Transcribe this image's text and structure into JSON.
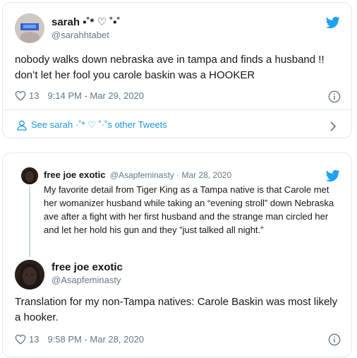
{
  "tweet1": {
    "display_name": "sarah ▪︎˚* ♡ ˚▪︎˚",
    "handle": "@sarahhtabet",
    "text": "nobody walks down nebraska ave in tampa and finds a husband !! don’t let her fool you carole baskin was a HOOKER",
    "likes": "13",
    "timestamp": "9:14 PM - Mar 29, 2020",
    "see_more": "See sarah ·˚* ♡ ˚·˚s other Tweets"
  },
  "tweet2": {
    "quoted": {
      "display_name": "free joe exotic",
      "handle_date": "@Asapfeminasty · Mar 28, 2020",
      "text": "My favorite detail from Tiger King as a Tampa native is that Carole met her womanizer husband while taking an “evening stroll” down Nebraska ave after a fight with her first husband and the strange man circled her and let her hold his gun and they ”just talked all night.”"
    },
    "display_name": "free joe exotic",
    "handle": "@Asapfeminasty",
    "text": "Translation for my non-Tampa natives: Carole Baskin was most likely a hooker.",
    "likes": "13",
    "timestamp": "9:58 PM - Mar 28, 2020"
  },
  "icons": {
    "brand": "twitter-bird-icon",
    "like": "heart-outline-icon",
    "info": "info-circle-icon",
    "profile": "person-icon",
    "chevron": "chevron-right-icon"
  },
  "colors": {
    "brand": "#1da1f2",
    "link": "#1b95e0",
    "secondary_text": "#657786",
    "border": "#e1e8ed"
  }
}
